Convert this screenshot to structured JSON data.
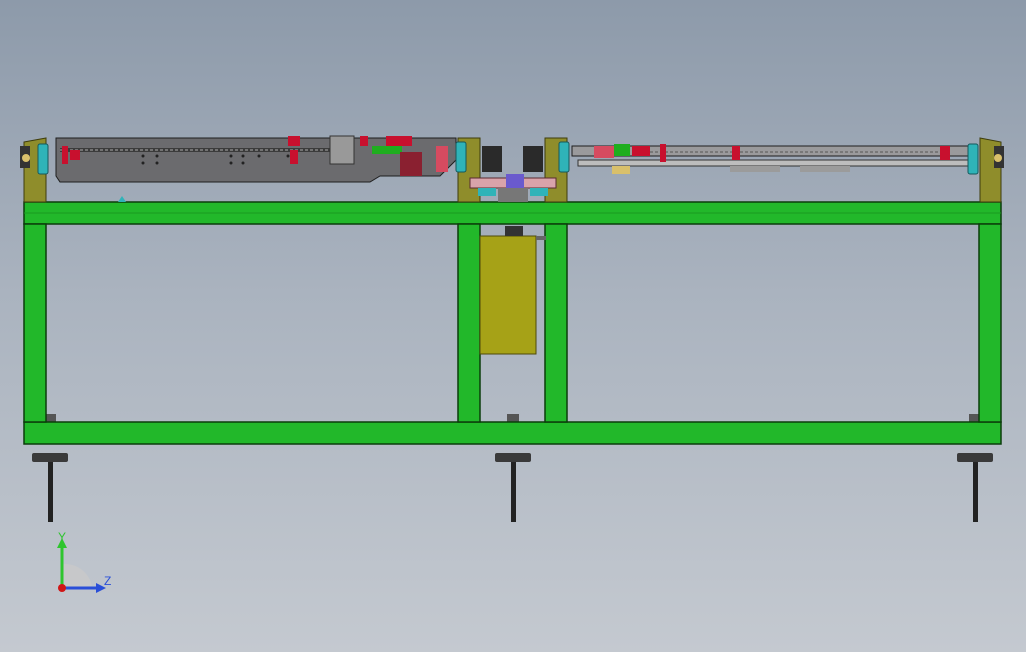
{
  "viewport": {
    "background_top": "#8d9aaa",
    "background_bottom": "#c4c9d0"
  },
  "model": {
    "frame_color": "#22b82a",
    "frame_outline": "#0b3d0b",
    "panel_color": "#a6a217",
    "bracket_color": "#8f8d2b",
    "accent_red": "#c8102e",
    "accent_teal": "#2fb3b8"
  },
  "triad": {
    "y_label": "Y",
    "z_label": "Z",
    "y_color": "#2ec52e",
    "z_color": "#2a4fd8",
    "x_color": "#d01616"
  }
}
